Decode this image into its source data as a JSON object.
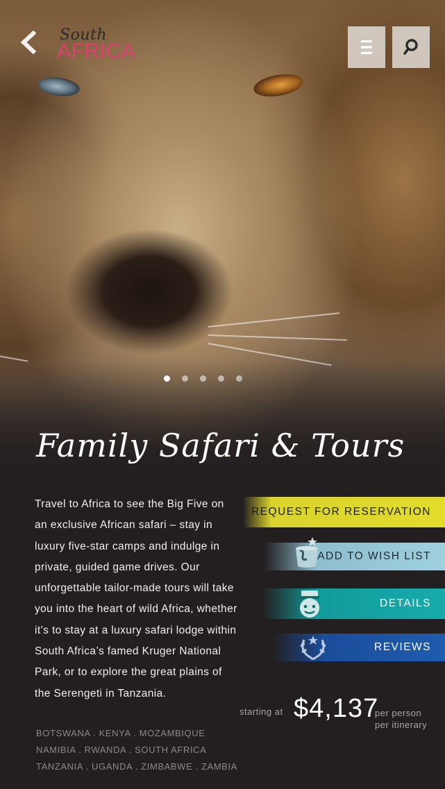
{
  "header": {
    "brand_top": "South",
    "brand_main": "AFRICA"
  },
  "carousel": {
    "slides": 5,
    "active": 1
  },
  "title": "Family Safari & Tours",
  "description": "Travel to Africa to see the Big Five on an exclusive African safari – stay in luxury five-star camps and indulge in private, guided game drives. Our unforgettable tailor-made tours will take you into the heart of wild Africa, whether it's to stay at a luxury safari lodge within South Africa's famed Kruger National Park, or to explore the great plains of the Serengeti in Tanzania.",
  "description_lines": [
    "Travel to Africa to see the Big Five on",
    "an exclusive African safari – stay in",
    "luxury five-star camps and indulge in",
    "private, guided game drives. Our",
    "unforgettable tailor-made tours will take",
    "you into the heart of wild Africa, whether",
    "it’s to stay at a luxury safari lodge within",
    "South Africa’s famed Kruger National",
    "Park, or to explore the great plains of",
    "the Serengeti in Tanzania."
  ],
  "actions": {
    "reservation": "REQUEST FOR RESERVATION",
    "wishlist": "ADD TO WISH LIST",
    "details": "DETAILS",
    "reviews": "REVIEWS"
  },
  "pricing": {
    "starting_label": "starting at",
    "price": "$4,137",
    "per_person": "per person",
    "per_itinerary": "per itinerary"
  },
  "countries": [
    "BOTSWANA . KENYA . MOZAMBIQUE",
    "NAMIBIA . RWANDA . SOUTH AFRICA",
    "TANZANIA . UGANDA . ZIMBABWE . ZAMBIA"
  ],
  "colors": {
    "background": "#231f20",
    "brand_pink": "#d8436e",
    "reservation_yellow": "#e2dc2c",
    "wishlist_lightblue": "#9fd0de",
    "details_teal": "#17abaa",
    "reviews_blue": "#1f5cae"
  },
  "icons": {
    "back": "chevron-left-icon",
    "menu": "hamburger-menu-icon",
    "search": "search-icon",
    "wishlist": "bucket-star-icon",
    "details": "bellhop-icon",
    "reviews": "laurel-wreath-icon"
  }
}
